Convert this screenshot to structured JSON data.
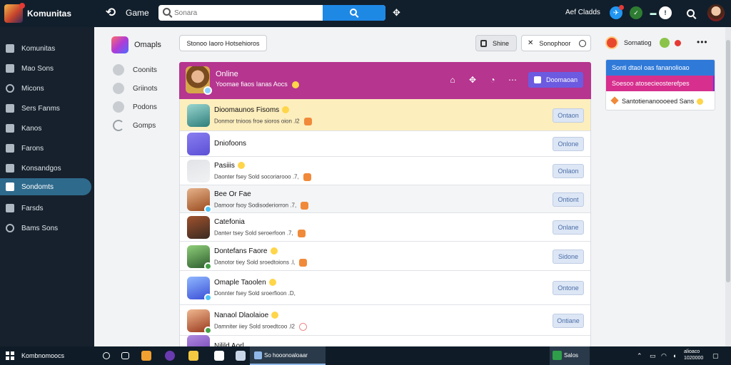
{
  "app": {
    "name": "Komunitas",
    "section_title": "Game",
    "user_name": "Aef Cladds"
  },
  "search": {
    "placeholder": "Sonara",
    "value": ""
  },
  "sidebar": {
    "items": [
      {
        "label": "Komunitas",
        "icon": "home-icon"
      },
      {
        "label": "Mao Sons",
        "icon": "inbox-icon"
      },
      {
        "label": "Micons",
        "icon": "message-icon"
      },
      {
        "label": "Sers Fanms",
        "icon": "bookmark-icon"
      },
      {
        "label": "Kanos",
        "icon": "gamepad-icon"
      },
      {
        "label": "Farons",
        "icon": "folder-icon"
      },
      {
        "label": "Konsandgos",
        "icon": "list-icon"
      },
      {
        "label": "Sondomts",
        "icon": "group-icon"
      },
      {
        "label": "Farsds",
        "icon": "pin-icon"
      },
      {
        "label": "Bams Sons",
        "icon": "settings-icon"
      }
    ],
    "active_index": 7
  },
  "categories": {
    "title": "Omapls",
    "items": [
      {
        "label": "Coonits",
        "icon": "compass-icon"
      },
      {
        "label": "Griinots",
        "icon": "shield-icon"
      },
      {
        "label": "Podons",
        "icon": "globe-icon"
      },
      {
        "label": "Gomps",
        "icon": "refresh-icon"
      }
    ]
  },
  "toolbar": {
    "filter_label": "Stonoo Iaoro Hotsehioros",
    "sort_label": "Shine",
    "view_label": "Sonophoor"
  },
  "panel_header": {
    "title": "Online",
    "subtitle": "Yoomae fiaos Ianas Aocs",
    "action_label": "Doomaoan"
  },
  "rows": [
    {
      "name": "Dioomaunos Fisoms",
      "desc": "Donmor tnioos froe sioros oion .l2",
      "button": "Ontaon",
      "avatar_colors": [
        "#2e7d7a",
        "#9ad6d0"
      ],
      "status": ""
    },
    {
      "name": "Dniofoons",
      "desc": "",
      "button": "Onlone",
      "avatar_colors": [
        "#5b4fd6",
        "#8a7ff0"
      ],
      "status": ""
    },
    {
      "name": "Pasiiis",
      "desc": "Daonter fsey Sold socoriarooo .7,",
      "button": "Onlaon",
      "avatar_colors": [
        "#f1f2f4",
        "#e1e3e6"
      ],
      "status": ""
    },
    {
      "name": "Bee Or Fae",
      "desc": "Damoor fsoy Sodisoderiorron .7,",
      "button": "Ontiont",
      "avatar_colors": [
        "#9a4b1e",
        "#e6b28a"
      ],
      "status": "#4fc3f7"
    },
    {
      "name": "Catefonia",
      "desc": "Danter tsey Sold seroerfoon .7,",
      "button": "Onlane",
      "avatar_colors": [
        "#3a2a22",
        "#a0522d"
      ],
      "status": ""
    },
    {
      "name": "Dontefans Faore",
      "desc": "Danotor tiey Sold sroedtoions .l,",
      "button": "Sidone",
      "avatar_colors": [
        "#2e5d2e",
        "#8fcf7a"
      ],
      "status": "#43a047"
    },
    {
      "name": "Omaple Taoolen",
      "desc": "Donnter fsey Sold sroerfioon .D,",
      "button": "Ontone",
      "avatar_colors": [
        "#3b4fd6",
        "#8fb8ff"
      ],
      "status": "#4fc3f7"
    },
    {
      "name": "Nanaol Dlaolaioe",
      "desc": "Damniter iiey Sold sroedtcoo .l2",
      "button": "Ontiane",
      "avatar_colors": [
        "#9a3a1e",
        "#f0b890"
      ],
      "status": "#43a047"
    },
    {
      "name": "Nilild Aorl",
      "desc": "",
      "button": "",
      "avatar_colors": [
        "#6a3ab0",
        "#b08ae0"
      ],
      "status": ""
    }
  ],
  "right_panel": {
    "name": "Sornatiog",
    "card": [
      "Sonti dtaol oas fananolioao",
      "Soesoo atosecieosterefpes",
      "Santotienanoooeed Sans"
    ]
  },
  "taskbar": {
    "label": "Kombnomoocs",
    "active_window": "So hooonoaloaar",
    "app2": "Salos",
    "clock_time": "alioaco",
    "clock_date": "1020000"
  }
}
